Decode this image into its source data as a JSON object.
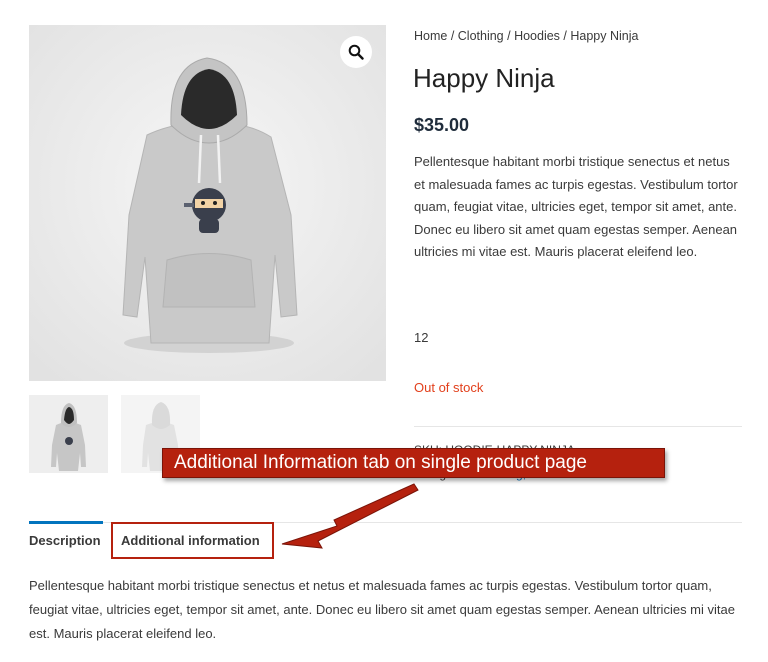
{
  "gallery": {
    "zoom_icon": "search-icon",
    "thumbnails": [
      "hoodie-front-thumbnail",
      "hoodie-back-thumbnail"
    ]
  },
  "breadcrumb": {
    "items": [
      "Home",
      "Clothing",
      "Hoodies",
      "Happy Ninja"
    ],
    "separator": " / "
  },
  "product": {
    "title": "Happy Ninja",
    "price": "$35.00",
    "short_description": "Pellentesque habitant morbi tristique senectus et netus et malesuada fames ac turpis egestas. Vestibulum tortor quam, feugiat vitae, ultricies eget, tempor sit amet, ante. Donec eu libero sit amet quam egestas semper. Aenean ultricies mi vitae est. Mauris placerat eleifend leo.",
    "quantity": "12",
    "stock_status": "Out of stock",
    "stock_color": "#e2401c",
    "sku_line": "SKU: HOODIE-HAPPY-NINJA",
    "categories_label": "Categories: ",
    "categories_links": "Clothing, Hoodies"
  },
  "annotation": {
    "callout_text": "Additional Information tab on single product page",
    "color": "#b5210e"
  },
  "tabs": {
    "items": [
      {
        "label": "Description",
        "active": true
      },
      {
        "label": "Additional information",
        "active": false
      }
    ],
    "active_color": "#0274be",
    "panel_text": "Pellentesque habitant morbi tristique senectus et netus et malesuada fames ac turpis egestas. Vestibulum tortor quam, feugiat vitae, ultricies eget, tempor sit amet, ante. Donec eu libero sit amet quam egestas semper. Aenean ultricies mi vitae est. Mauris placerat eleifend leo."
  }
}
